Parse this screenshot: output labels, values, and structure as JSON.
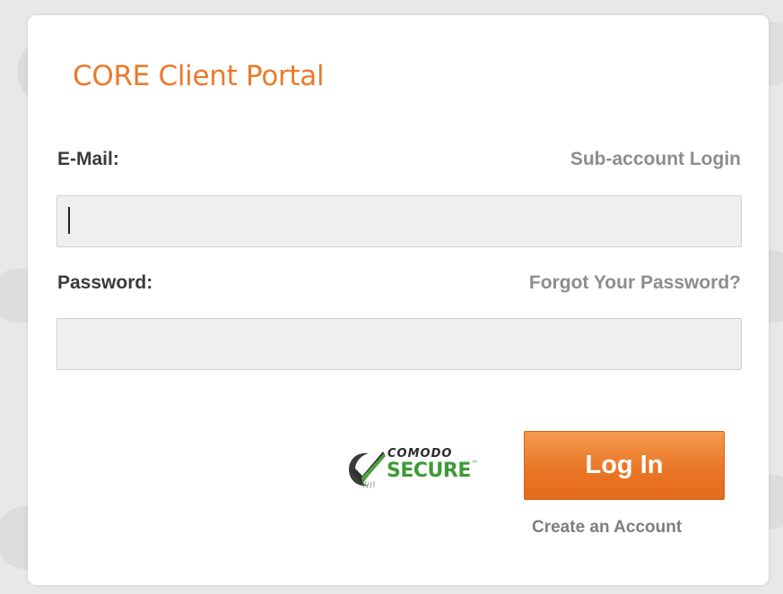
{
  "portal": {
    "title": "CORE Client Portal"
  },
  "form": {
    "email_label": "E-Mail:",
    "email_value": "",
    "email_placeholder": "",
    "subaccount_link": "Sub-account Login",
    "password_label": "Password:",
    "password_value": "",
    "password_placeholder": "",
    "forgot_link": "Forgot Your Password?"
  },
  "security_badge": {
    "brand": "COMODO",
    "text": "SECURE",
    "trademark": "™",
    "icon": "comodo-check-icon"
  },
  "actions": {
    "login_label": "Log In",
    "create_account_label": "Create an Account"
  },
  "colors": {
    "brand_orange": "#ec7a2a",
    "button_orange": "#ea7626",
    "secure_green": "#3d9b37"
  }
}
